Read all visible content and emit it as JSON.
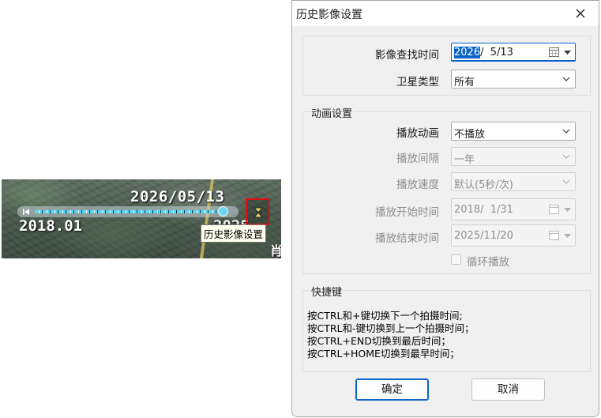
{
  "timeline": {
    "current_date": "2026/05/13",
    "start_date": "2018.01",
    "partial_date": "2025",
    "tooltip": "历史影像设置",
    "progress": 0.95
  },
  "dialog": {
    "title": "历史影像设置",
    "top_group": {
      "imagery_date_label": "影像查找时间",
      "imagery_date_year": "2026",
      "imagery_date_rest": "/  5/13",
      "satellite_label": "卫星类型",
      "satellite_value": "所有"
    },
    "animation_group": {
      "title": "动画设置",
      "play_label": "播放动画",
      "play_value": "不播放",
      "interval_label": "播放间隔",
      "interval_value": "一年",
      "speed_label": "播放速度",
      "speed_value": "默认(5秒/次)",
      "start_label": "播放开始时间",
      "start_value": "2018/  1/31",
      "end_label": "播放结束时间",
      "end_value": "2025/11/20",
      "loop_label": "循环播放",
      "loop_checked": false
    },
    "hotkey_group": {
      "title": "快捷键",
      "lines": [
        "按CTRL和+键切换下一个拍摄时间;",
        "按CTRL和-键切换到上一个拍摄时间；",
        "按CTRL+END切换到最后时间；",
        "按CTRL+HOME切换到最早时间；"
      ]
    },
    "ok_label": "确定",
    "cancel_label": "取消"
  },
  "colors": {
    "accent": "#0a64c8",
    "timeline_tick": "#55d6f2",
    "highlight_box": "#e01010"
  }
}
